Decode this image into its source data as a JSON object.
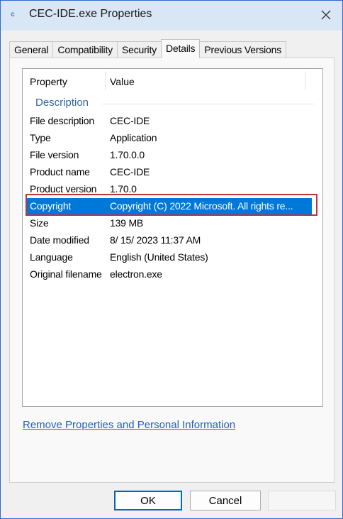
{
  "window": {
    "title": "CEC-IDE.exe Properties",
    "app_icon_glyph": "c"
  },
  "tabs": [
    {
      "label": "General",
      "active": false
    },
    {
      "label": "Compatibility",
      "active": false
    },
    {
      "label": "Security",
      "active": false
    },
    {
      "label": "Details",
      "active": true
    },
    {
      "label": "Previous Versions",
      "active": false
    }
  ],
  "details": {
    "columns": {
      "property": "Property",
      "value": "Value"
    },
    "group_label": "Description",
    "rows": [
      {
        "property": "File description",
        "value": "CEC-IDE"
      },
      {
        "property": "Type",
        "value": "Application"
      },
      {
        "property": "File version",
        "value": "1.70.0.0"
      },
      {
        "property": "Product name",
        "value": "CEC-IDE"
      },
      {
        "property": "Product version",
        "value": "1.70.0"
      },
      {
        "property": "Copyright",
        "value": "Copyright (C) 2022 Microsoft. All rights re..."
      },
      {
        "property": "Size",
        "value": "139 MB"
      },
      {
        "property": "Date modified",
        "value": "8/ 15/ 2023 11:37 AM"
      },
      {
        "property": "Language",
        "value": "English (United States)"
      },
      {
        "property": "Original filename",
        "value": "electron.exe"
      }
    ],
    "selected_row": "Copyright"
  },
  "link": {
    "label": "Remove Properties and Personal Information"
  },
  "buttons": {
    "ok": "OK",
    "cancel": "Cancel"
  },
  "colors": {
    "selection": "#0078d7",
    "highlight_box": "#c0313f",
    "link": "#2461b5"
  }
}
